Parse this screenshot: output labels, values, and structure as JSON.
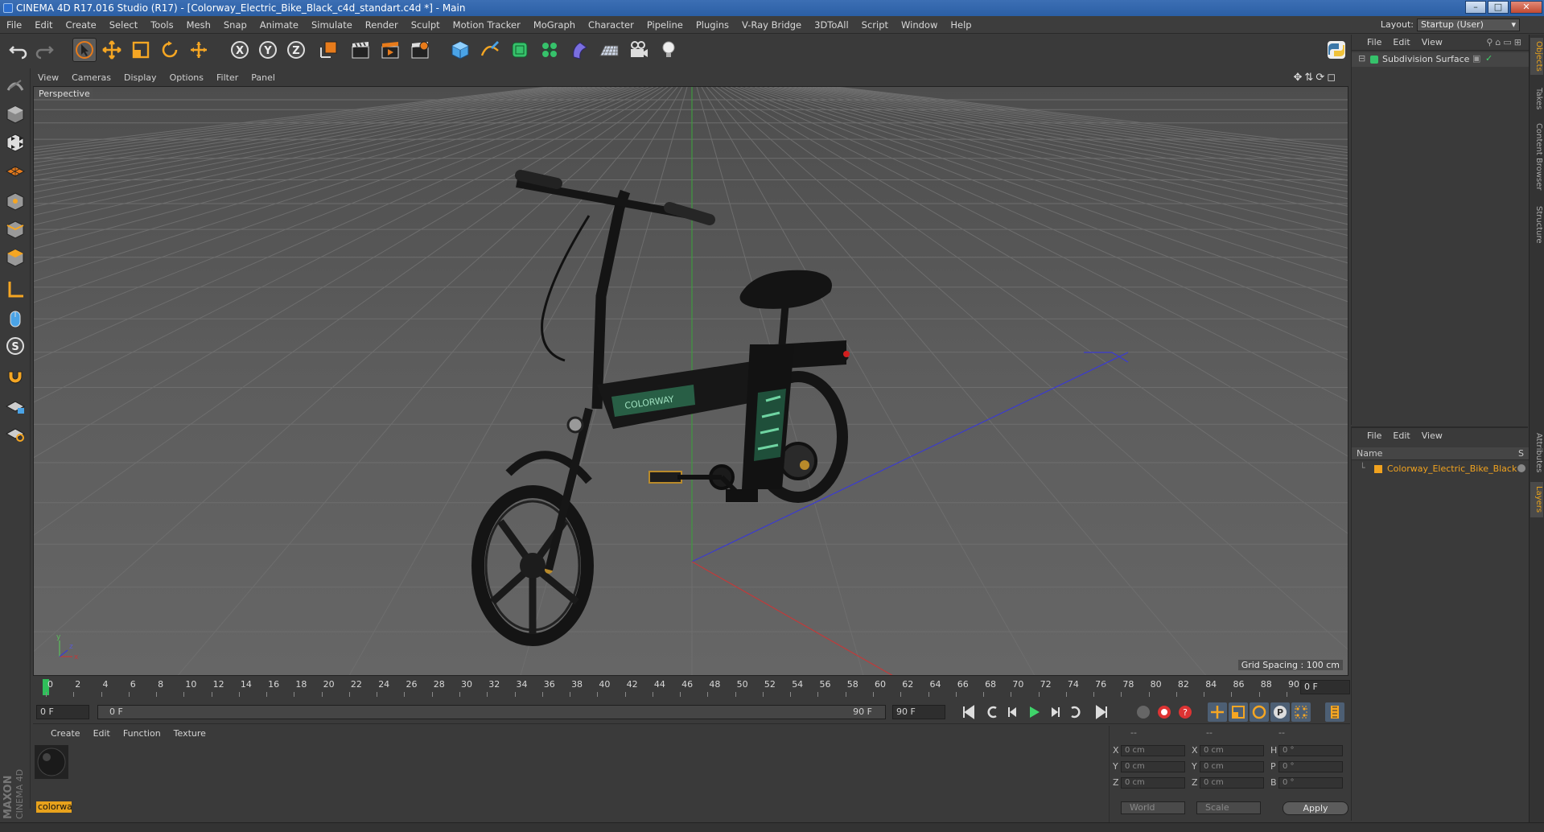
{
  "window": {
    "title": "CINEMA 4D R17.016 Studio (R17) - [Colorway_Electric_Bike_Black_c4d_standart.c4d *] - Main"
  },
  "menubar": {
    "items": [
      "File",
      "Edit",
      "Create",
      "Select",
      "Tools",
      "Mesh",
      "Snap",
      "Animate",
      "Simulate",
      "Render",
      "Sculpt",
      "Motion Tracker",
      "MoGraph",
      "Character",
      "Pipeline",
      "Plugins",
      "V-Ray Bridge",
      "3DToAll",
      "Script",
      "Window",
      "Help"
    ],
    "layout_label": "Layout:",
    "layout_value": "Startup (User)"
  },
  "viewport": {
    "menu": [
      "View",
      "Cameras",
      "Display",
      "Options",
      "Filter",
      "Panel"
    ],
    "camera_label": "Perspective",
    "grid_spacing": "Grid Spacing : 100 cm"
  },
  "timeline": {
    "ticks": [
      "0",
      "2",
      "4",
      "6",
      "8",
      "10",
      "12",
      "14",
      "16",
      "18",
      "20",
      "22",
      "24",
      "26",
      "28",
      "30",
      "32",
      "34",
      "36",
      "38",
      "40",
      "42",
      "44",
      "46",
      "48",
      "50",
      "52",
      "54",
      "56",
      "58",
      "60",
      "62",
      "64",
      "66",
      "68",
      "70",
      "72",
      "74",
      "76",
      "78",
      "80",
      "82",
      "84",
      "86",
      "88",
      "90"
    ],
    "current_frame": "0 F"
  },
  "playbar": {
    "start_frame": "0 F",
    "range_start": "0 F",
    "range_end": "90 F",
    "end_frame": "90 F"
  },
  "material_panel": {
    "menu": [
      "Create",
      "Edit",
      "Function",
      "Texture"
    ],
    "material_name": "colorwa"
  },
  "coords": {
    "header": [
      "--",
      "--",
      "--"
    ],
    "rows": [
      {
        "a": "X",
        "av": "0 cm",
        "b": "X",
        "bv": "0 cm",
        "c": "H",
        "cv": "0 °"
      },
      {
        "a": "Y",
        "av": "0 cm",
        "b": "Y",
        "bv": "0 cm",
        "c": "P",
        "cv": "0 °"
      },
      {
        "a": "Z",
        "av": "0 cm",
        "b": "Z",
        "bv": "0 cm",
        "c": "B",
        "cv": "0 °"
      }
    ],
    "mode1": "World",
    "mode2": "Scale",
    "apply": "Apply"
  },
  "objects_panel": {
    "menu": [
      "File",
      "Edit",
      "View"
    ],
    "object_name": "Subdivision Surface"
  },
  "layers_panel": {
    "menu": [
      "File",
      "Edit",
      "View"
    ],
    "col_name": "Name",
    "col_s": "S",
    "layer_name": "Colorway_Electric_Bike_Black",
    "layer_color": "#f0a21f"
  },
  "side_tabs": [
    "Objects",
    "Takes",
    "Content Browser",
    "Structure",
    "Attributes",
    "Layers"
  ],
  "brand": {
    "line1": "MAXON",
    "line2": "CINEMA 4D"
  }
}
